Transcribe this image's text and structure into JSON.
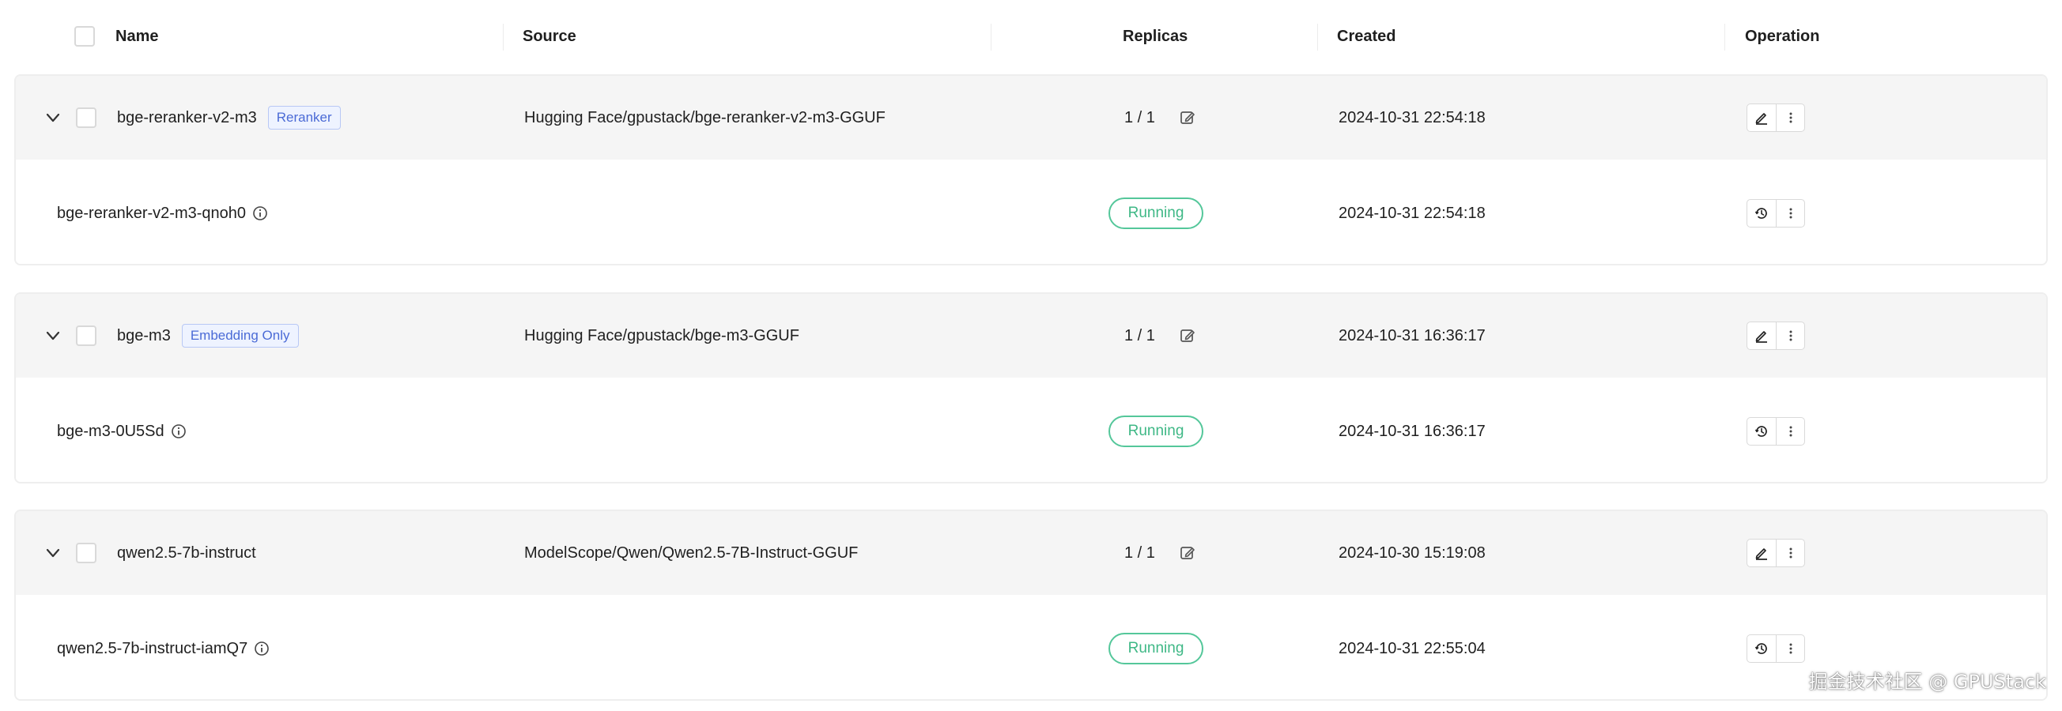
{
  "columns": {
    "name": "Name",
    "source": "Source",
    "replicas": "Replicas",
    "created": "Created",
    "operation": "Operation"
  },
  "groups": [
    {
      "name": "bge-reranker-v2-m3",
      "tag": "Reranker",
      "source": "Hugging Face/gpustack/bge-reranker-v2-m3-GGUF",
      "replicas": "1 / 1",
      "created": "2024-10-31 22:54:18",
      "instance": {
        "name": "bge-reranker-v2-m3-qnoh0",
        "status": "Running",
        "created": "2024-10-31 22:54:18"
      }
    },
    {
      "name": "bge-m3",
      "tag": "Embedding Only",
      "source": "Hugging Face/gpustack/bge-m3-GGUF",
      "replicas": "1 / 1",
      "created": "2024-10-31 16:36:17",
      "instance": {
        "name": "bge-m3-0U5Sd",
        "status": "Running",
        "created": "2024-10-31 16:36:17"
      }
    },
    {
      "name": "qwen2.5-7b-instruct",
      "tag": "",
      "source": "ModelScope/Qwen/Qwen2.5-7B-Instruct-GGUF",
      "replicas": "1 / 1",
      "created": "2024-10-30 15:19:08",
      "instance": {
        "name": "qwen2.5-7b-instruct-iamQ7",
        "status": "Running",
        "created": "2024-10-31 22:55:04"
      }
    }
  ],
  "watermark": "掘金技术社区 @ GPUStack",
  "icons": {
    "expand": "chevron-down-icon",
    "info": "info-circle-icon",
    "edit_replicas": "edit-square-icon",
    "edit": "pencil-icon",
    "more": "more-vertical-icon",
    "logs": "history-clock-icon"
  },
  "colors": {
    "running": "#3fb886",
    "tag_text": "#4b6bd6",
    "tag_bg": "#eef3ff",
    "row_bg": "#f5f5f5"
  }
}
